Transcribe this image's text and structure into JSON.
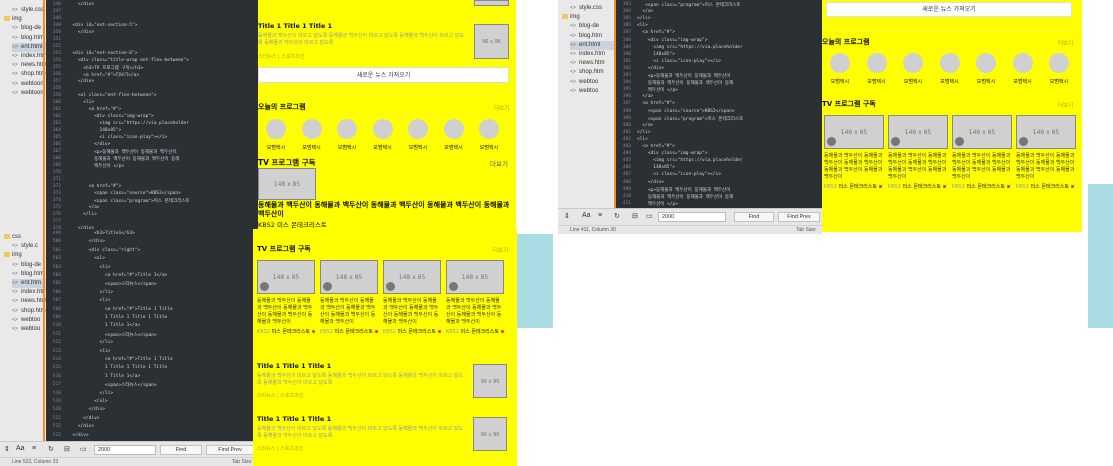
{
  "quad_tl": {
    "tree": [
      {
        "label": "style.css",
        "kind": "css"
      },
      {
        "label": "img",
        "kind": "folder"
      },
      {
        "label": "blog-de",
        "kind": "html"
      },
      {
        "label": "blog.htm",
        "kind": "html"
      },
      {
        "label": "ent.html",
        "kind": "html",
        "selected": true
      },
      {
        "label": "index.htm",
        "kind": "html"
      },
      {
        "label": "news.htm",
        "kind": "html"
      },
      {
        "label": "shop.htm",
        "kind": "html"
      },
      {
        "label": "webtoon",
        "kind": "html"
      },
      {
        "label": "webtoon",
        "kind": "html"
      }
    ],
    "lines": [
      "346",
      "347",
      "348",
      "349",
      "350",
      "351",
      "352",
      "353",
      "354",
      "355",
      "356",
      "357",
      "358",
      "359",
      "360",
      "361",
      "362",
      "363",
      "364",
      "365",
      "366",
      "367",
      "368",
      "369",
      "370",
      "371",
      "372",
      "373",
      "374",
      "375",
      "376",
      "377",
      "378"
    ],
    "code": [
      {
        "t": "    </div>"
      },
      {
        "t": ""
      },
      {
        "t": ""
      },
      {
        "t": "  <div id=\"ent-section-5\">"
      },
      {
        "t": "    </div>"
      },
      {
        "t": ""
      },
      {
        "t": ""
      },
      {
        "t": "  <div id=\"ent-section-6\">"
      },
      {
        "t": "    <div class=\"title-wrap ent-flex-between\">"
      },
      {
        "t": "      <h3>TV 프로그램 구독</h3>"
      },
      {
        "t": "      <a href=\"#\">더보기</a>"
      },
      {
        "t": "    </div>"
      },
      {
        "t": ""
      },
      {
        "t": "    <ul class=\"ent-flex-between\">"
      },
      {
        "t": "      <li>"
      },
      {
        "t": "        <a href=\"#\">"
      },
      {
        "t": "          <div class=\"img-wrap\">"
      },
      {
        "t": "            <img src=\"https://via.placeholder"
      },
      {
        "t": "            148x85\">"
      },
      {
        "t": "            <i class=\"icon-play\"></i>"
      },
      {
        "t": "          </div>"
      },
      {
        "t": "          <p>동해물과 백두산이 동해물과 백두산이"
      },
      {
        "t": "          동해물과 백두산이 동해물과 백두산이 동해"
      },
      {
        "t": "          백두산이 </p>"
      },
      {
        "t": ""
      },
      {
        "t": ""
      },
      {
        "t": "        <a href=\"#\">"
      },
      {
        "t": "          <span class=\"source\">KBS2</span>"
      },
      {
        "t": "          <span class=\"program\">미스 몬테크리스토"
      },
      {
        "t": "        </a>"
      },
      {
        "t": "      </li>"
      },
      {
        "t": ""
      },
      {
        "t": "    </div>"
      }
    ],
    "preview": {
      "item_title": "Title 1 Title 1 Title 1",
      "item_desc": "동해물과 백두산이 마르고 닳도록 동해물과 백두산이 마르고 닳도록 동해물과 백두산이 마르고 닳도록 동해물과 백두산이 마르고 닳도록",
      "item_meta": "스타뉴스 | 스포츠조선",
      "thumb": "96 x 96",
      "news_btn": "새로운 뉴스 가져오기",
      "today_title": "오늘의 프로그램",
      "today_more": "더보기",
      "today_items": [
        "모범택시",
        "모범택시",
        "모범택시",
        "모범택시",
        "모범택시",
        "모범택시",
        "모범택시"
      ],
      "tv_title": "TV 프로그램 구독",
      "tv_more": "더보기",
      "tv_thumb": "148 x 85",
      "tv_desc": "동해물과 백두산이 동해물과 백두산이 동해물과 백두산이 동해물과 백두산이 동해물과 백두산이",
      "tv_source": "KBS2",
      "tv_program": "미스 몬테크리스토"
    }
  },
  "quad_tr": {
    "tree": [
      {
        "label": "style.css",
        "kind": "css"
      },
      {
        "label": "img",
        "kind": "folder"
      },
      {
        "label": "blog-de",
        "kind": "html"
      },
      {
        "label": "blog.htm",
        "kind": "html"
      },
      {
        "label": "ent.html",
        "kind": "html",
        "selected": true
      },
      {
        "label": "index.htm",
        "kind": "html"
      },
      {
        "label": "news.htm",
        "kind": "html"
      },
      {
        "label": "shop.htm",
        "kind": "html"
      },
      {
        "label": "webtoo",
        "kind": "html"
      },
      {
        "label": "webtoo",
        "kind": "html"
      }
    ],
    "lines": [
      "383",
      "384",
      "385",
      "386",
      "387",
      "388",
      "389",
      "390",
      "391",
      "392",
      "393",
      "394",
      "395",
      "396",
      "397",
      "398",
      "399",
      "400",
      "401",
      "402",
      "403",
      "404",
      "405",
      "406",
      "407",
      "408",
      "409",
      "410",
      "411"
    ],
    "code": [
      {
        "t": "   <span class=\"program\">미스 몬테크리스토"
      },
      {
        "t": "  </a>"
      },
      {
        "t": "</li>"
      },
      {
        "t": "<li>"
      },
      {
        "t": "  <a href=\"#\">"
      },
      {
        "t": "    <div class=\"img-wrap\">"
      },
      {
        "t": "      <img src=\"https://via.placeholder"
      },
      {
        "t": "      148x85\">"
      },
      {
        "t": "      <i class=\"icon-play\"></i>"
      },
      {
        "t": "    </div>"
      },
      {
        "t": "    <p>동해물과 백두산이 동해물과 백두산이"
      },
      {
        "t": "    동해물과 백두산이 동해물과 백두산이 동해"
      },
      {
        "t": "    백두산이 </p>"
      },
      {
        "t": "  </a>"
      },
      {
        "t": "  <a href=\"#\">"
      },
      {
        "t": "    <span class=\"source\">KBS2</span>"
      },
      {
        "t": "    <span class=\"program\">미스 몬테크리스토"
      },
      {
        "t": "  </a>"
      },
      {
        "t": "</li>"
      },
      {
        "t": "<li>"
      },
      {
        "t": "  <a href=\"#\">"
      },
      {
        "t": "    <div class=\"img-wrap\">"
      },
      {
        "t": "      <img src=\"https://via.placeholder"
      },
      {
        "t": "      148x85\">"
      },
      {
        "t": "      <i class=\"icon-play\"></i>"
      },
      {
        "t": "    </div>"
      },
      {
        "t": "    <p>동해물과 백두산이 동해물과 백두산이"
      },
      {
        "t": "    동해물과 백두산이 동해물과 백두산이 동해"
      },
      {
        "t": "    백두산이 </p>"
      }
    ],
    "find_value": "2000",
    "find_label": "Find",
    "find_prev_label": "Find Prev",
    "status": "Line 411, Column 30",
    "status_right": "Tab Size:",
    "preview": {
      "news_btn": "새로운 뉴스 가져오기",
      "today_title": "오늘의 프로그램",
      "today_more": "더보기",
      "today_items": [
        "모범택시",
        "모범택시",
        "모범택시",
        "모범택시",
        "모범택시",
        "모범택시",
        "모범택시"
      ],
      "tv_title": "TV 프로그램 구독",
      "tv_more": "더보기",
      "tv_thumb": "148 x 85",
      "tv_desc": "동해물과 백두산이 동해물과 백두산이 동해물과 백두산이 동해물과 백두산이 동해물과 백두산이",
      "tv_source": "KBS2",
      "tv_program": "미스 몬테크리스토"
    }
  },
  "quad_bl": {
    "tree": [
      {
        "label": "css",
        "kind": "folder"
      },
      {
        "label": "style.c",
        "kind": "css"
      },
      {
        "label": "img",
        "kind": "folder"
      },
      {
        "label": "blog-de",
        "kind": "html"
      },
      {
        "label": "blog.htm",
        "kind": "html"
      },
      {
        "label": "ent.htm",
        "kind": "html",
        "selected": true
      },
      {
        "label": "index.htm",
        "kind": "html"
      },
      {
        "label": "news.htm",
        "kind": "html"
      },
      {
        "label": "shop.htm",
        "kind": "html"
      },
      {
        "label": "webtoo",
        "kind": "html"
      },
      {
        "label": "webtoo",
        "kind": "html"
      }
    ],
    "lines": [
      "499",
      "500",
      "501",
      "502",
      "503",
      "504",
      "505",
      "506",
      "507",
      "508",
      "509",
      "510",
      "511",
      "512",
      "513",
      "514",
      "515",
      "516",
      "517",
      "518",
      "519",
      "520",
      "521",
      "522",
      "523"
    ],
    "code": [
      {
        "t": "          <h3>Title1</h3>"
      },
      {
        "t": "        </div>"
      },
      {
        "t": "        <div class=\"right\">"
      },
      {
        "t": "          <ul>"
      },
      {
        "t": "            <li>"
      },
      {
        "t": "              <a href=\"#\">Title 1</a>"
      },
      {
        "t": "              <span>스타뉴스</span>"
      },
      {
        "t": "            </li>"
      },
      {
        "t": "            <li>"
      },
      {
        "t": "              <a href=\"#\">Title 1 Title"
      },
      {
        "t": "              1 Title 1 Title 1 Title"
      },
      {
        "t": "              1 Title 1</a>"
      },
      {
        "t": "              <span>스타뉴스</span>"
      },
      {
        "t": "            </li>"
      },
      {
        "t": "            <li>"
      },
      {
        "t": "              <a href=\"#\">Title 1 Title"
      },
      {
        "t": "              1 Title 1 Title 1 Title"
      },
      {
        "t": "              1 Title 1</a>"
      },
      {
        "t": "              <span>스타뉴스</span>"
      },
      {
        "t": "            </li>"
      },
      {
        "t": "          </ul>"
      },
      {
        "t": "        </div>"
      },
      {
        "t": "      </div>"
      },
      {
        "t": "    </div>"
      },
      {
        "t": "  </div>"
      }
    ],
    "find_value": "2000",
    "find_label": "Find",
    "find_prev_label": "Find Prev",
    "status": "Line 523, Column 23",
    "status_right": "Tab Size:",
    "preview": {
      "tv_title": "TV 프로그램 구독",
      "tv_more": "더보기",
      "tv_thumb": "148 x 85",
      "tv_desc": "동해물과 백두산이 동해물과 백두산이 동해물과 백두산이 동해물과 백두산이 동해물과 백두산이",
      "tv_source": "KBS2",
      "tv_program": "미스 몬테크리스토",
      "item_title": "Title 1 Title 1 Title 1",
      "item_desc": "동해물과 백두산이 마르고 닳도록 동해물과 백두산이 마르고 닳도록 동해물과 백두산이 마르고 닳도록 동해물과 백두산이 마르고 닳도록",
      "item_meta": "스타뉴스 | 스포츠조선",
      "thumb": "96 x 96"
    }
  }
}
